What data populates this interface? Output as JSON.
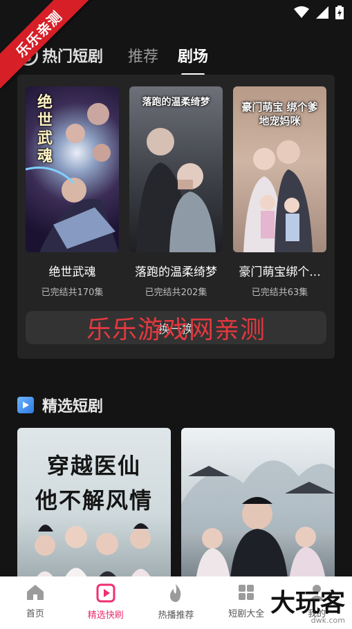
{
  "watermark": {
    "ribbon": "乐乐亲测",
    "overlay": "乐乐游戏网亲测",
    "corner_main": "大玩客",
    "corner_sub": "dwk.com"
  },
  "header": {
    "section_title": "热门短剧",
    "tabs": [
      {
        "label": "推荐",
        "active": false
      },
      {
        "label": "剧场",
        "active": true
      }
    ]
  },
  "featured": {
    "items": [
      {
        "title": "绝世武魂",
        "subtitle": "已完结共170集",
        "poster_text": "绝世武魂"
      },
      {
        "title": "落跑的温柔绮梦",
        "subtitle": "已完结共202集",
        "poster_text": "落跑的温柔绮梦"
      },
      {
        "title": "豪门萌宝绑个...",
        "subtitle": "已完结共63集",
        "poster_text": "豪门萌宝 绑个爹地宠妈咪"
      }
    ],
    "swap_label": "换一换"
  },
  "selected": {
    "title": "精选短剧",
    "items": [
      {
        "poster_text_1": "穿越医仙",
        "poster_text_2": "他不解风情"
      },
      {
        "poster_text_1": "",
        "poster_text_2": ""
      }
    ]
  },
  "bottom_nav": [
    {
      "label": "首页",
      "icon": "home-icon",
      "active": false
    },
    {
      "label": "精选快刷",
      "icon": "play-icon",
      "active": true
    },
    {
      "label": "热播推荐",
      "icon": "flame-icon",
      "active": false
    },
    {
      "label": "短剧大全",
      "icon": "grid-icon",
      "active": false
    },
    {
      "label": "我的",
      "icon": "user-icon",
      "active": false
    }
  ],
  "colors": {
    "background": "#141414",
    "panel": "#242424",
    "accent": "#ef2f6e",
    "watermark_red": "#e4393f"
  }
}
